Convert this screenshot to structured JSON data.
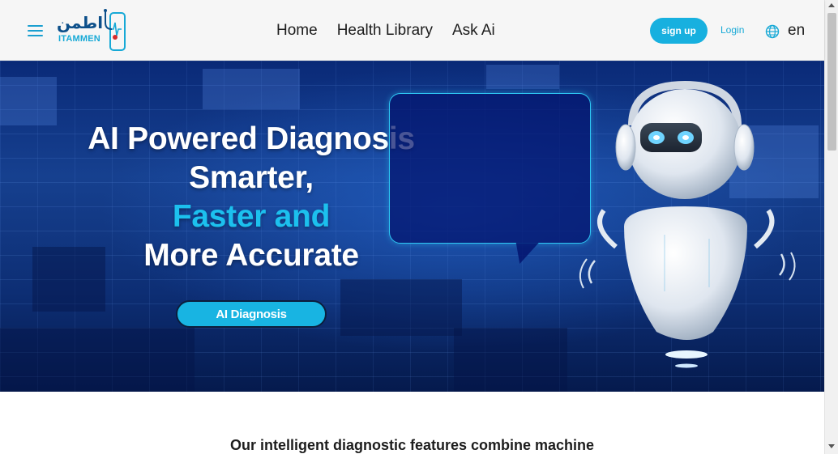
{
  "header": {
    "logo_arabic": "اطمن",
    "logo_latin": "ITAMMEN",
    "nav": [
      {
        "label": "Home"
      },
      {
        "label": "Health Library"
      },
      {
        "label": "Ask Ai"
      }
    ],
    "signup_label": "sign up",
    "login_label": "Login",
    "language": "en",
    "icons": {
      "menu": "hamburger-menu-icon",
      "language": "globe-icon",
      "logo": "stethoscope-phone-logo"
    }
  },
  "hero": {
    "title_line1": "AI Powered Diagnosis",
    "title_line2": "Smarter,",
    "title_line3": "Faster and",
    "title_line4": "More Accurate",
    "cta_label": "AI Diagnosis"
  },
  "content": {
    "intro_text": "Our intelligent diagnostic features combine machine"
  },
  "colors": {
    "accent": "#17b0df",
    "highlight": "#1cc0ee",
    "brand_dark": "#0c4f8a",
    "hero_bg": "#0a2a78"
  }
}
